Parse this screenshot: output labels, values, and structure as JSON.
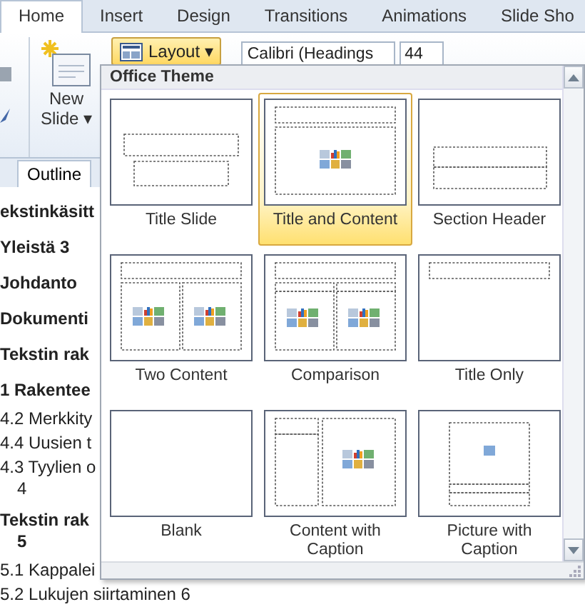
{
  "ribbon_tabs": [
    {
      "label": "Home",
      "selected": true
    },
    {
      "label": "Insert",
      "selected": false
    },
    {
      "label": "Design",
      "selected": false
    },
    {
      "label": "Transitions",
      "selected": false
    },
    {
      "label": "Animations",
      "selected": false
    },
    {
      "label": "Slide Sho",
      "selected": false
    }
  ],
  "ribbon": {
    "new_slide": "New",
    "new_slide_2": "Slide",
    "new_slide_caret": "▾",
    "layout_button": {
      "label": "Layout",
      "caret": "▾",
      "pressed": true
    },
    "font_name": "Calibri (Headings",
    "font_size": "44"
  },
  "side_tabs": [
    {
      "label": "Outline",
      "selected": true
    }
  ],
  "outline": [
    {
      "text": "ekstinkäsitt",
      "bold": true
    },
    {
      "text": "Yleistä  3",
      "bold": true
    },
    {
      "text": "Johdanto",
      "bold": true
    },
    {
      "text": "Dokumenti",
      "bold": true
    },
    {
      "text": "Tekstin rak",
      "bold": true
    },
    {
      "text": "1 Rakentee",
      "bold": true
    },
    {
      "text": "4.2 Merkkity",
      "bold": false
    },
    {
      "text": "4.4 Uusien t",
      "bold": false
    },
    {
      "text": "4.3 Tyylien o",
      "page": "4",
      "bold": false
    },
    {
      "text": "Tekstin rak",
      "page": "5",
      "bold": true
    },
    {
      "text": "5.1 Kappalei",
      "bold": false
    },
    {
      "text": "5.2 Lukujen siirtaminen   6",
      "bold": false
    }
  ],
  "gallery": {
    "title": "Office Theme",
    "layouts": [
      {
        "label": "Title Slide",
        "kind": "title-slide",
        "selected": false
      },
      {
        "label": "Title and Content",
        "kind": "title-content",
        "selected": true
      },
      {
        "label": "Section Header",
        "kind": "section-header",
        "selected": false
      },
      {
        "label": "Two Content",
        "kind": "two-content",
        "selected": false
      },
      {
        "label": "Comparison",
        "kind": "comparison",
        "selected": false
      },
      {
        "label": "Title Only",
        "kind": "title-only",
        "selected": false
      },
      {
        "label": "Blank",
        "kind": "blank",
        "selected": false
      },
      {
        "label": "Content with Caption",
        "kind": "content-caption",
        "selected": false
      },
      {
        "label": "Picture with Caption",
        "kind": "picture-caption",
        "selected": false
      }
    ]
  }
}
